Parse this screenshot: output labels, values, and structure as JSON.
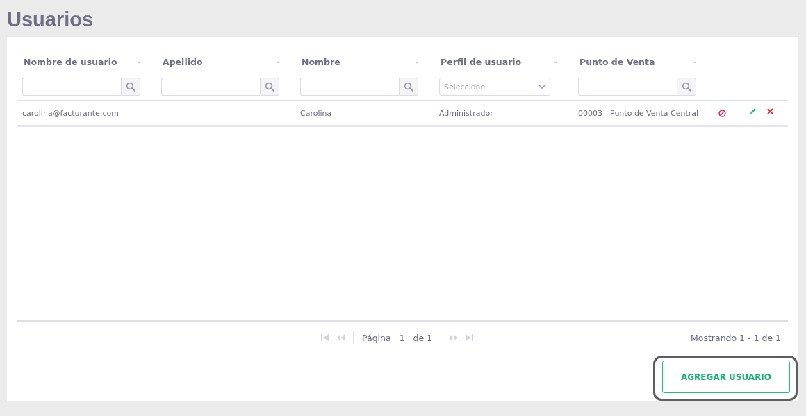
{
  "title": "Usuarios",
  "table": {
    "columns": [
      {
        "label": "Nombre de usuario",
        "filter": {
          "kind": "search"
        }
      },
      {
        "label": "Apellido",
        "filter": {
          "kind": "search"
        }
      },
      {
        "label": "Nombre",
        "filter": {
          "kind": "search"
        }
      },
      {
        "label": "Perfil de usuario",
        "filter": {
          "kind": "select",
          "placeholder": "Seleccione"
        }
      },
      {
        "label": "Punto de Venta",
        "filter": {
          "kind": "search"
        }
      }
    ],
    "rows": [
      {
        "cells": [
          "carolina@facturante.com",
          "",
          "Carolina",
          "Administrador",
          "00003 - Punto de Venta Central"
        ]
      }
    ]
  },
  "pagination": {
    "page_label": "Página",
    "page": "1",
    "of_label": "de 1",
    "summary": "Mostrando 1 - 1 de 1"
  },
  "add_button": {
    "label": "AGREGAR USUARIO",
    "highlighted": true
  }
}
